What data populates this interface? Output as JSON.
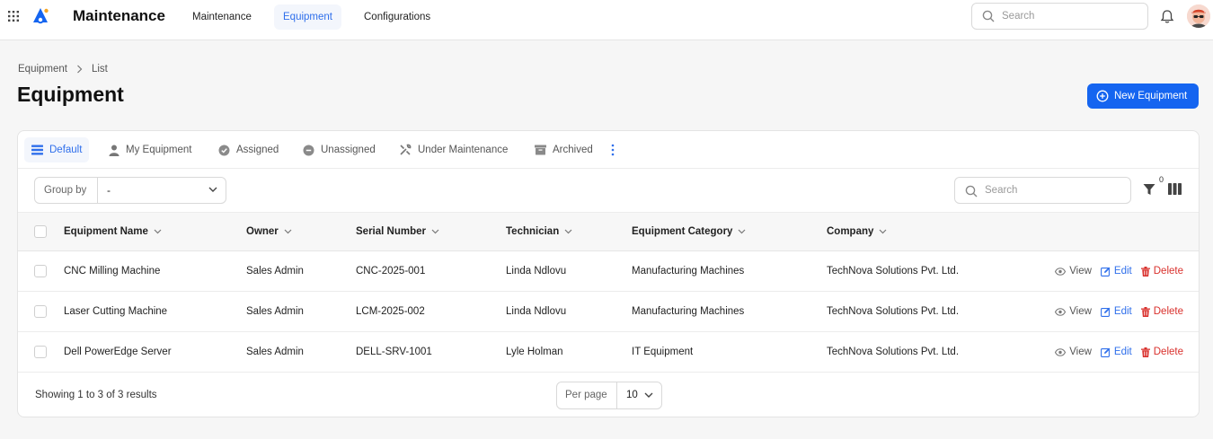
{
  "header": {
    "app_title": "Maintenance",
    "nav": [
      "Maintenance",
      "Equipment",
      "Configurations"
    ],
    "search_placeholder": "Search"
  },
  "breadcrumb": [
    "Equipment",
    "List"
  ],
  "page_title": "Equipment",
  "new_button_label": "New Equipment",
  "tabs": [
    "Default",
    "My Equipment",
    "Assigned",
    "Unassigned",
    "Under Maintenance",
    "Archived"
  ],
  "toolbar": {
    "group_by_label": "Group by",
    "group_by_value": "-",
    "search_placeholder": "Search",
    "filter_count": "0"
  },
  "table": {
    "columns": [
      "Equipment Name",
      "Owner",
      "Serial Number",
      "Technician",
      "Equipment Category",
      "Company"
    ],
    "rows": [
      [
        "CNC Milling Machine",
        "Sales Admin",
        "CNC-2025-001",
        "Linda Ndlovu",
        "Manufacturing Machines",
        "TechNova Solutions Pvt. Ltd."
      ],
      [
        "Laser Cutting Machine",
        "Sales Admin",
        "LCM-2025-002",
        "Linda Ndlovu",
        "Manufacturing Machines",
        "TechNova Solutions Pvt. Ltd."
      ],
      [
        "Dell PowerEdge Server",
        "Sales Admin",
        "DELL-SRV-1001",
        "Lyle Holman",
        "IT Equipment",
        "TechNova Solutions Pvt. Ltd."
      ]
    ],
    "actions": {
      "view": "View",
      "edit": "Edit",
      "delete": "Delete"
    }
  },
  "footer": {
    "results_text": "Showing 1 to 3 of 3 results",
    "per_page_label": "Per page",
    "per_page_value": "10"
  },
  "colors": {
    "accent": "#1565f0",
    "danger": "#d9302c"
  }
}
